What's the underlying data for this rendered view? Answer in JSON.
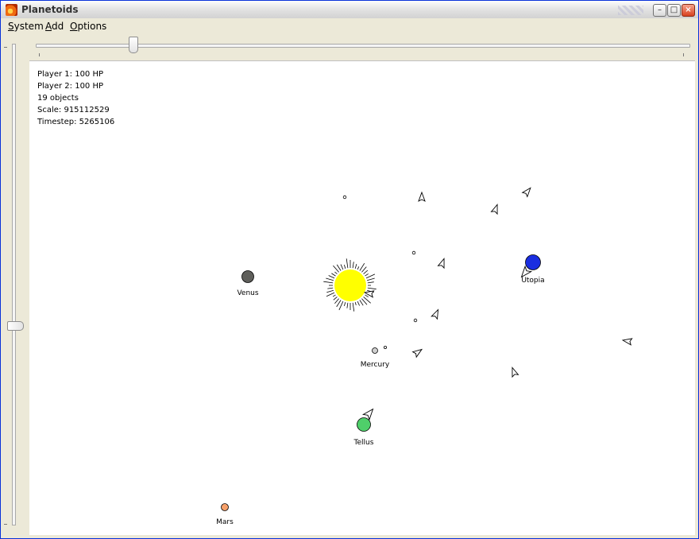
{
  "window": {
    "title": "Planetoids"
  },
  "menu": {
    "system": {
      "label": "System",
      "mnemonic": "S",
      "rest": "ystem"
    },
    "add": {
      "label": "Add",
      "mnemonic": "A",
      "rest": "dd"
    },
    "options": {
      "label": "Options",
      "mnemonic": "O",
      "rest": "ptions"
    }
  },
  "hud": {
    "player1": "Player 1: 100 HP",
    "player2": "Player 2: 100 HP",
    "objects": "19 objects",
    "scale": "Scale: 915112529",
    "timestep": "Timestep: 5265106"
  },
  "sliders": {
    "horizontal_level": 0.15,
    "vertical_level": 0.59
  },
  "bodies": [
    {
      "name": "Venus",
      "color": "#5f5f5b"
    },
    {
      "name": "Utopia",
      "color": "#1a2ee0"
    },
    {
      "name": "Mercury",
      "color": "#cfcfcf"
    },
    {
      "name": "Tellus",
      "color": "#4fcf6a"
    },
    {
      "name": "Mars",
      "color": "#f6a06a"
    }
  ],
  "sun": {
    "color": "#ffff00"
  }
}
